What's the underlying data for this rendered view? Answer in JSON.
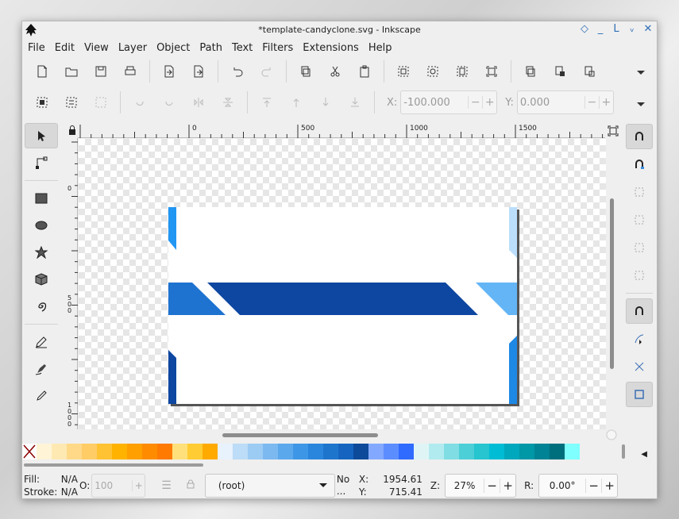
{
  "window": {
    "title": "*template-candyclone.svg - Inkscape",
    "controls": [
      "◇",
      "_",
      "L",
      "ᵥ",
      "✕"
    ]
  },
  "menubar": {
    "items": [
      "File",
      "Edit",
      "View",
      "Layer",
      "Object",
      "Path",
      "Text",
      "Filters",
      "Extensions",
      "Help"
    ]
  },
  "toolbar": {
    "buttons": [
      "new-document-icon",
      "open-icon",
      "save-icon",
      "print-icon",
      "import-icon",
      "export-icon",
      "undo-icon",
      "redo-icon",
      "copy-icon",
      "cut-icon",
      "paste-icon",
      "zoom-selection-icon",
      "zoom-drawing-icon",
      "zoom-page-icon",
      "zoom-page-width-icon",
      "duplicate-icon",
      "clone-icon",
      "unlink-clone-icon"
    ]
  },
  "coordbar": {
    "x_label": "X:",
    "x_value": "-100.000",
    "y_label": "Y:",
    "y_value": "0.000"
  },
  "rulers": {
    "top_ticks": [
      "0",
      "500",
      "1000",
      "1500"
    ],
    "left_ticks": [
      "0",
      "5\n0\n0",
      "1\n0\n0\n0"
    ]
  },
  "palette": {
    "colors": [
      "#fff4d6",
      "#ffe9b3",
      "#ffd988",
      "#ffcc66",
      "#ffc233",
      "#ffb300",
      "#ff9f00",
      "#ff8c00",
      "#ff7a00",
      "#ffe07a",
      "#ffcc33",
      "#ffaa00",
      "#e8f2fd",
      "#bcdcf7",
      "#9ccbf4",
      "#7cb9f0",
      "#5ca8ec",
      "#3e97e6",
      "#2a86dc",
      "#1e75cc",
      "#1565c0",
      "#0d4a9a",
      "#82a9ff",
      "#5c8dff",
      "#2f6bff",
      "#dff5f5",
      "#b2ebef",
      "#7fdde3",
      "#4dcfd8",
      "#26c5cf",
      "#00bcd4",
      "#00a8bd",
      "#0097a7",
      "#008394",
      "#006f7d",
      "#7fffff"
    ]
  },
  "status": {
    "fill_label": "Fill:",
    "fill_value": "N/A",
    "stroke_label": "Stroke:",
    "stroke_value": "N/A",
    "opacity_label": "O:",
    "opacity_value": "100",
    "layer": "(root)",
    "no_objects_line1": "No",
    "no_objects_line2": "...",
    "x_label": "X:",
    "x_value": "1954.61",
    "y_label": "Y:",
    "y_value": "715.41",
    "zoom_label": "Z:",
    "zoom_value": "27%",
    "rotate_label": "R:",
    "rotate_value": "0.00°"
  }
}
